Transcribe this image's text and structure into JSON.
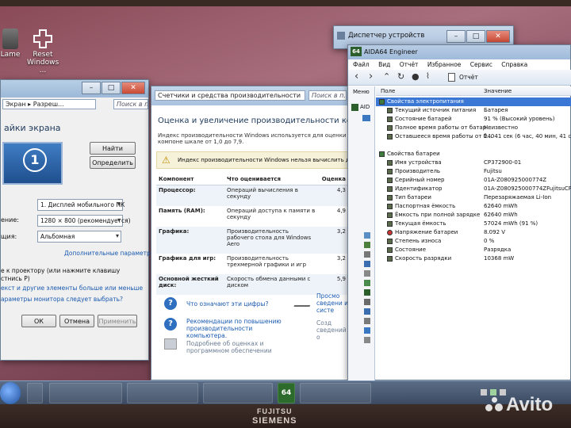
{
  "desktop": {
    "icons": [
      {
        "label": "Lame"
      },
      {
        "label": "Reset Windows ..."
      }
    ]
  },
  "display_window": {
    "address_root": "Экран",
    "address_leaf": "Разреш...",
    "search_placeholder": "Поиск в пан...",
    "heading": "айки экрана",
    "monitor_number": "1",
    "detect_button": "Найти",
    "identify_button": "Определить",
    "display_label": "",
    "display_value": "1. Дисплей мобильного ПК",
    "resolution_label": "ение:",
    "resolution_value": "1280 × 800 (рекомендуется)",
    "orientation_label": "щия:",
    "orientation_value": "Альбомная",
    "advanced_link": "Дополнительные параметры",
    "projector_text_1": "е к проектору (или нажмите клавишу",
    "projector_text_2": "стнись P)",
    "size_link": "екст и другие элементы больше или меньше",
    "monitor_link": "араметры монитора следует выбрать?",
    "ok_button": "ОК",
    "cancel_button": "Отмена",
    "apply_button": "Применить"
  },
  "perf_window": {
    "address": "Счетчики и средства производительности",
    "search_placeholder": "Поиск в п...",
    "title": "Оценка и увеличение производительности компьютера",
    "intro": "Индекс производительности Windows используется для оценки компоне шкале от 1,0 до 7,9.",
    "warning": "Индекс производительности Windows нельзя вычислить для прои",
    "columns": {
      "component": "Компонент",
      "rated": "Что оценивается",
      "score": "Оценка"
    },
    "rows": [
      {
        "component": "Процессор:",
        "rated": "Операций вычисления в секунду",
        "score": "4,3"
      },
      {
        "component": "Память (RAM):",
        "rated": "Операций доступа к памяти в секунду",
        "score": "4,9"
      },
      {
        "component": "Графика:",
        "rated": "Производительность рабочего стола для Windows Aero",
        "score": "3,2"
      },
      {
        "component": "Графика для игр:",
        "rated": "Производительность трехмерной графики и игр",
        "score": "3,2"
      },
      {
        "component": "Основной жесткий диск:",
        "rated": "Скорость обмена данными с диском",
        "score": "5,9"
      }
    ],
    "link_what": "Что означают эти цифры?",
    "link_tips": "Рекомендации по повышению производительности компьютера.",
    "link_details": "Подробнее об оценках и программном обеспечении",
    "link_side": "Просмо сведени и систе",
    "link_side2": "Созд сведений о"
  },
  "devmgr_window": {
    "title": "Диспетчер устройств"
  },
  "aida_window": {
    "title": "AIDA64 Engineer",
    "title_badge": "64",
    "menu": [
      "Файл",
      "Вид",
      "Отчёт",
      "Избранное",
      "Сервис",
      "Справка"
    ],
    "report_button": "Отчёт",
    "left_tab": "Меню",
    "left_item": "AID",
    "col_field": "Поле",
    "col_value": "Значение",
    "group_power": "Свойства электропитания",
    "power_rows": [
      {
        "field": "Текущий источник питания",
        "value": "Батарея"
      },
      {
        "field": "Состояние батарей",
        "value": "91 % (Высокий уровень)"
      },
      {
        "field": "Полное время работы от батар...",
        "value": "Неизвестно"
      },
      {
        "field": "Оставшееся время работы от б...",
        "value": "24041 сек (6 час, 40 мин, 41 сек)"
      }
    ],
    "group_battery": "Свойства батареи",
    "battery_rows": [
      {
        "field": "Имя устройства",
        "value": "CP372900-01"
      },
      {
        "field": "Производитель",
        "value": "Fujitsu"
      },
      {
        "field": "Серийный номер",
        "value": "01A-Z080925000774Z"
      },
      {
        "field": "Идентификатор",
        "value": "01A-Z080925000774ZFujitsuCP372"
      },
      {
        "field": "Тип батареи",
        "value": "Перезаряжаемая Li-Ion"
      },
      {
        "field": "Паспортная ёмкость",
        "value": "62640 mWh"
      },
      {
        "field": "Ёмкость при полной зарядке",
        "value": "62640 mWh"
      },
      {
        "field": "Текущая ёмкость",
        "value": "57024 mWh (91 %)"
      },
      {
        "field": "Напряжение батареи",
        "value": "8.092 V"
      },
      {
        "field": "Степень износа",
        "value": "0 %"
      },
      {
        "field": "Состояние",
        "value": "Разрядка"
      },
      {
        "field": "Скорость разрядки",
        "value": "10368 mW"
      }
    ]
  },
  "taskbar": {
    "aida_badge": "64"
  },
  "bezel": {
    "brand_top": "FUJITSU",
    "brand_bottom": "SIEMENS"
  },
  "watermark": {
    "text": "Avito"
  }
}
